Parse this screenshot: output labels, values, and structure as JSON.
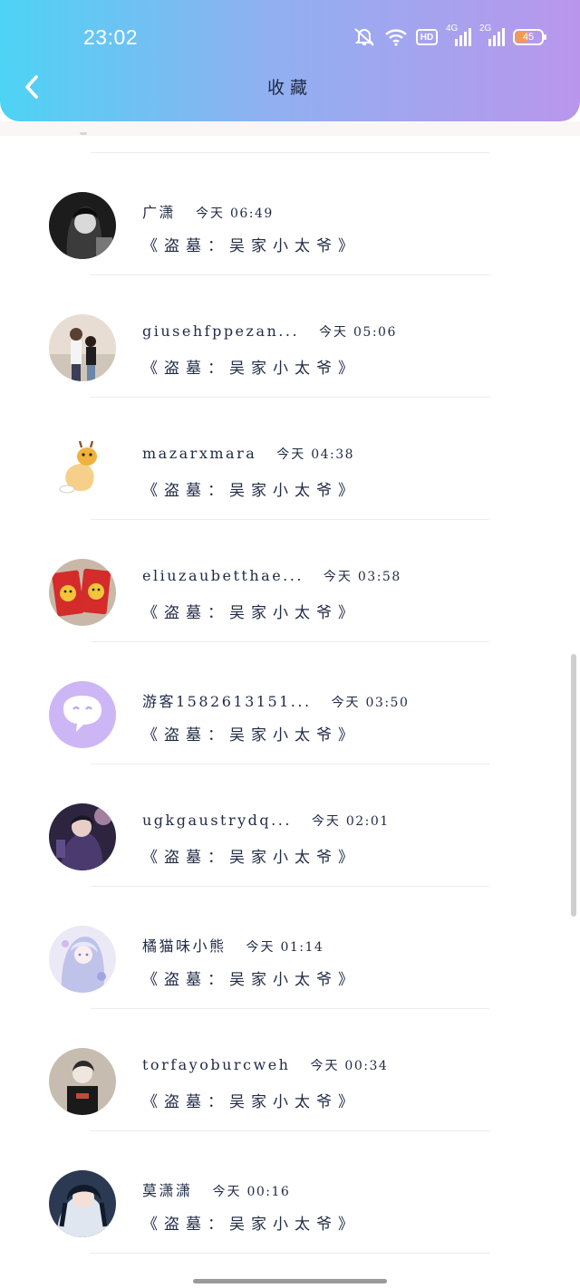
{
  "status_bar": {
    "time": "23:02",
    "hd_label": "HD",
    "net1_label": "4G",
    "net2_label": "2G",
    "battery_percent": "45"
  },
  "header": {
    "title": "收藏",
    "back_icon": "chevron-left-icon"
  },
  "colors": {
    "header_gradient_start": "#4dd3f5",
    "header_gradient_end": "#b996ec",
    "text": "#1f2a44"
  },
  "favorites": [
    {
      "name": "广潇",
      "day": "今天",
      "clock": "06:49",
      "title": "《盗墓：吴家小太爷》"
    },
    {
      "name": "giusehfppezan...",
      "day": "今天",
      "clock": "05:06",
      "title": "《盗墓：吴家小太爷》"
    },
    {
      "name": "mazarxmara",
      "day": "今天",
      "clock": "04:38",
      "title": "《盗墓：吴家小太爷》"
    },
    {
      "name": "eliuzaubetthae...",
      "day": "今天",
      "clock": "03:58",
      "title": "《盗墓：吴家小太爷》"
    },
    {
      "name": "游客1582613151...",
      "day": "今天",
      "clock": "03:50",
      "title": "《盗墓：吴家小太爷》"
    },
    {
      "name": "ugkgaustrydq...",
      "day": "今天",
      "clock": "02:01",
      "title": "《盗墓：吴家小太爷》"
    },
    {
      "name": "橘猫味小熊",
      "day": "今天",
      "clock": "01:14",
      "title": "《盗墓：吴家小太爷》"
    },
    {
      "name": "torfayoburcweh",
      "day": "今天",
      "clock": "00:34",
      "title": "《盗墓：吴家小太爷》"
    },
    {
      "name": "莫潇潇",
      "day": "今天",
      "clock": "00:16",
      "title": "《盗墓：吴家小太爷》"
    }
  ]
}
